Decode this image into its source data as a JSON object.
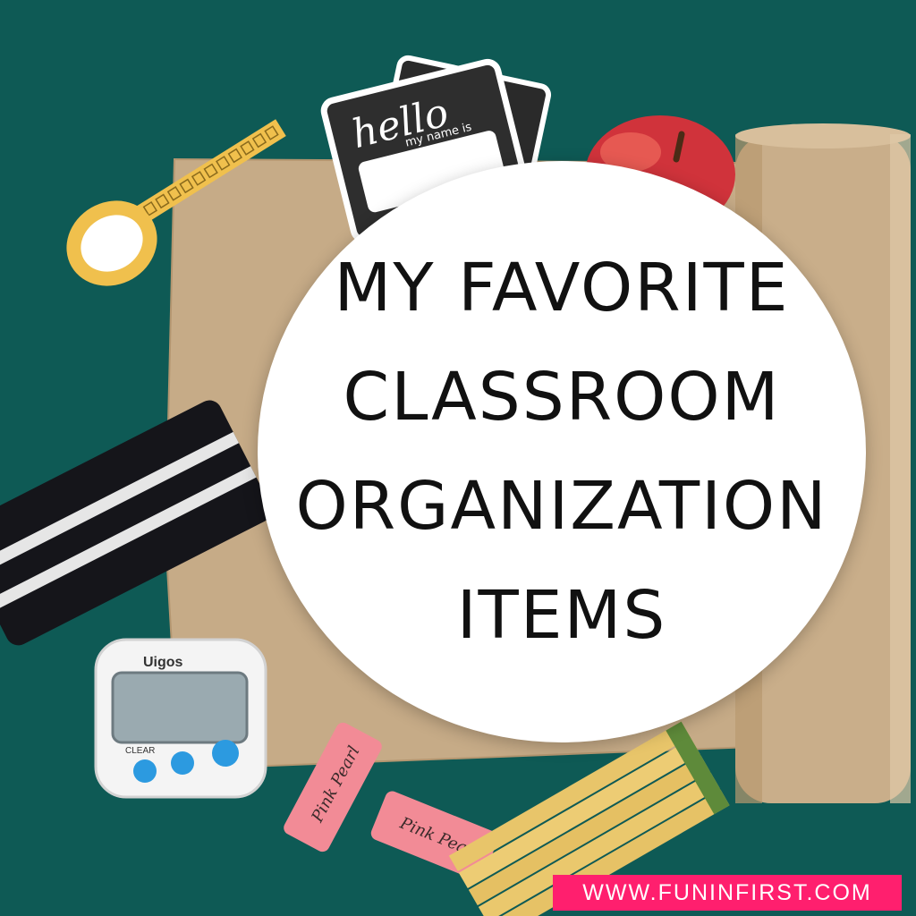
{
  "title_lines": [
    "MY FAVORITE",
    "CLASSROOM",
    "ORGANIZATION",
    "ITEMS"
  ],
  "website": "WWW.FUNINFIRST.COM",
  "name_tag": {
    "greeting": "hello",
    "subline": "my name is"
  },
  "timer": {
    "brand": "Uigos",
    "button_label": "CLEAR"
  },
  "colors": {
    "background": "#0e5a55",
    "kraft_paper": "#c6ab87",
    "banner": "#ff1f6e",
    "pencil": "#e8c56a",
    "eraser": "#f28b96"
  },
  "icons": [
    "washi-tape-icon",
    "name-tag-icon",
    "apple-icon",
    "paper-roll-icon",
    "felt-strip-icon",
    "timer-icon",
    "eraser-icon",
    "pencil-icon"
  ]
}
